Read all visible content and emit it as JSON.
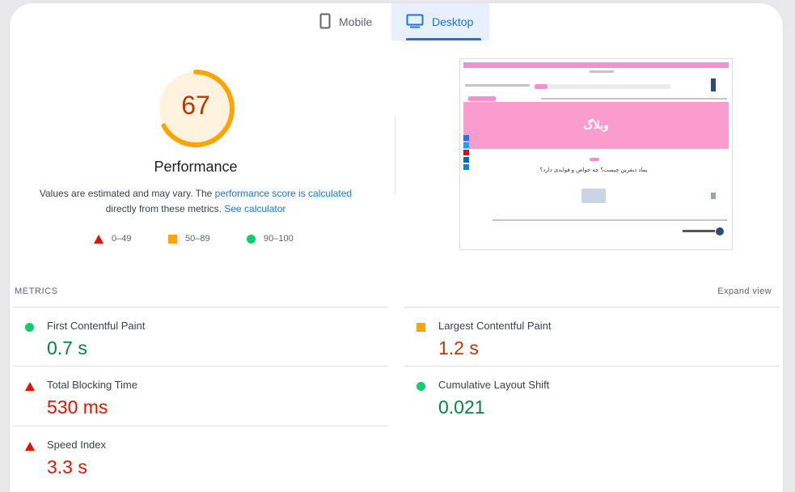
{
  "tabs": {
    "mobile": {
      "label": "Mobile",
      "icon": "smartphone-icon"
    },
    "desktop": {
      "label": "Desktop",
      "icon": "monitor-icon",
      "selected": true
    }
  },
  "performance": {
    "score": "67",
    "score_fraction": 0.67,
    "score_color": "#ffa400",
    "title": "Performance",
    "desc_part1": "Values are estimated and may vary. The ",
    "desc_link1": "performance score is calculated",
    "desc_part2": " directly from these metrics. ",
    "desc_link2": "See calculator",
    "legend": [
      {
        "range": "0–49",
        "shape": "triangle",
        "color": "#eb0f00"
      },
      {
        "range": "50–89",
        "shape": "square",
        "color": "#ffa400"
      },
      {
        "range": "90–100",
        "shape": "circle",
        "color": "#0cce6b"
      }
    ]
  },
  "thumbnail": {
    "hero_text": "وبلاگ",
    "article_title": "پماد دیفرین چیست؟ چه خواص و فوایدی دارد؟"
  },
  "metrics": {
    "title": "METRICS",
    "expand": "Expand view",
    "items": [
      {
        "label": "First Contentful Paint",
        "value": "0.7 s",
        "status": "good"
      },
      {
        "label": "Largest Contentful Paint",
        "value": "1.2 s",
        "status": "average"
      },
      {
        "label": "Total Blocking Time",
        "value": "530 ms",
        "status": "poor"
      },
      {
        "label": "Cumulative Layout Shift",
        "value": "0.021",
        "status": "good"
      },
      {
        "label": "Speed Index",
        "value": "3.3 s",
        "status": "poor"
      }
    ]
  }
}
